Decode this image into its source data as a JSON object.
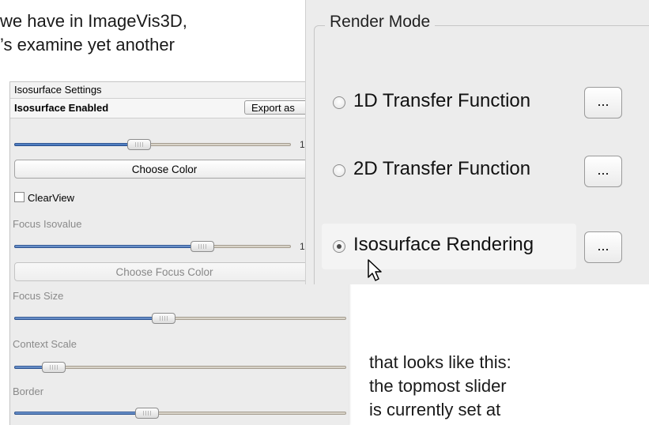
{
  "document": {
    "top_line1": "we have in ImageVis3D,",
    "top_line2": "’s examine yet another",
    "bottom_line1": "that looks like this:",
    "bottom_line2": "the topmost slider",
    "bottom_line3": "is currently set at"
  },
  "iso_panel": {
    "header": "Isosurface Settings",
    "enabled_label": "Isosurface Enabled",
    "export_button": "Export as",
    "iso_slider_value": 0.45,
    "iso_slider_end": "1",
    "choose_color": "Choose Color",
    "clearview_label": "ClearView",
    "focus_isovalue_label": "Focus Isovalue",
    "focus_slider_value": 0.68,
    "focus_slider_end": "1",
    "choose_focus_color": "Choose Focus Color",
    "focus_size_label": "Focus Size",
    "focus_size_value": 0.45,
    "context_scale_label": "Context Scale",
    "context_scale_value": 0.12,
    "border_label": "Border",
    "border_value": 0.4
  },
  "render_mode": {
    "title": "Render Mode",
    "options": [
      {
        "label": "1D Transfer Function",
        "checked": false,
        "button": "..."
      },
      {
        "label": "2D Transfer Function",
        "checked": false,
        "button": "..."
      },
      {
        "label": "Isosurface Rendering",
        "checked": true,
        "button": "..."
      }
    ]
  },
  "colors": {
    "slider_fill": "#2f5ea8",
    "panel_bg": "#ececec"
  }
}
